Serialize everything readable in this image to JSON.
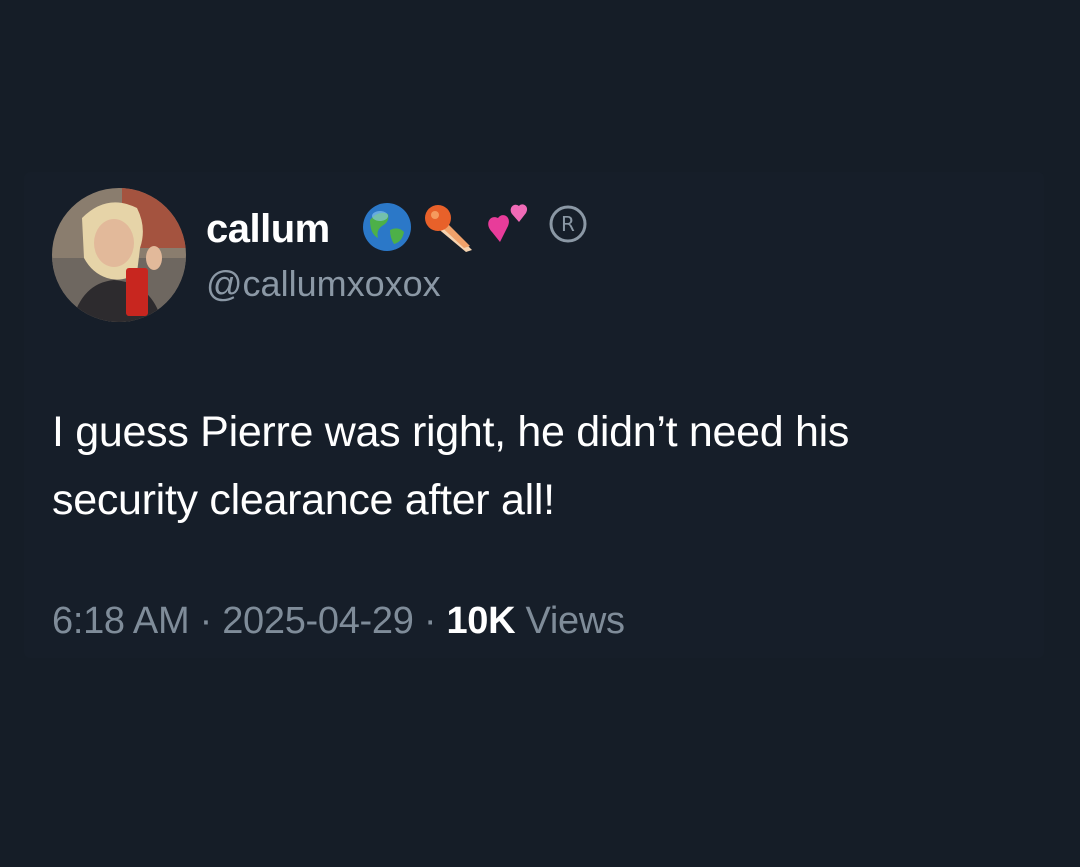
{
  "author": {
    "display_name": "callum",
    "handle": "@callumxoxox",
    "badges": [
      "globe-icon",
      "meteor-icon",
      "two-hearts-icon",
      "registered-icon"
    ]
  },
  "tweet": {
    "text_line1": "I guess Pierre was right, he didn’t need his",
    "text_line2": "security clearance after all!"
  },
  "meta": {
    "time": "6:18 AM",
    "separator1": " · ",
    "date": "2025-04-29",
    "separator2": " · ",
    "views_count": "10K",
    "views_label": " Views"
  },
  "colors": {
    "background": "#151d27",
    "primary_text": "#ffffff",
    "secondary_text": "#8b98a5"
  }
}
